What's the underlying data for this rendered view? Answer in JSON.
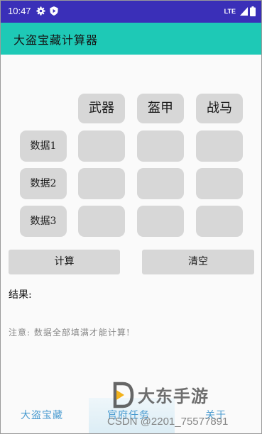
{
  "status_bar": {
    "time": "10:47",
    "network": "LTE",
    "icons": [
      "gear-icon",
      "play-shield-icon",
      "signal-icon",
      "battery-icon"
    ]
  },
  "app_bar": {
    "title": "大盗宝藏计算器",
    "color": "#1ec9b6"
  },
  "grid": {
    "columns": [
      "武器",
      "盔甲",
      "战马"
    ],
    "rows": [
      {
        "label": "数据1",
        "values": [
          "",
          "",
          ""
        ]
      },
      {
        "label": "数据2",
        "values": [
          "",
          "",
          ""
        ]
      },
      {
        "label": "数据3",
        "values": [
          "",
          "",
          ""
        ]
      }
    ]
  },
  "actions": {
    "calculate": "计算",
    "clear": "清空"
  },
  "result": {
    "label": "结果:",
    "value": ""
  },
  "notice": "注意: 数据全部填满才能计算!",
  "bottom_nav": {
    "items": [
      "大盗宝藏",
      "官府任务",
      "关于"
    ],
    "active_index": 1,
    "color": "#4a9bd0"
  },
  "watermarks": {
    "brand": "大东手游",
    "csdn": "CSDN @2201_75577891"
  }
}
